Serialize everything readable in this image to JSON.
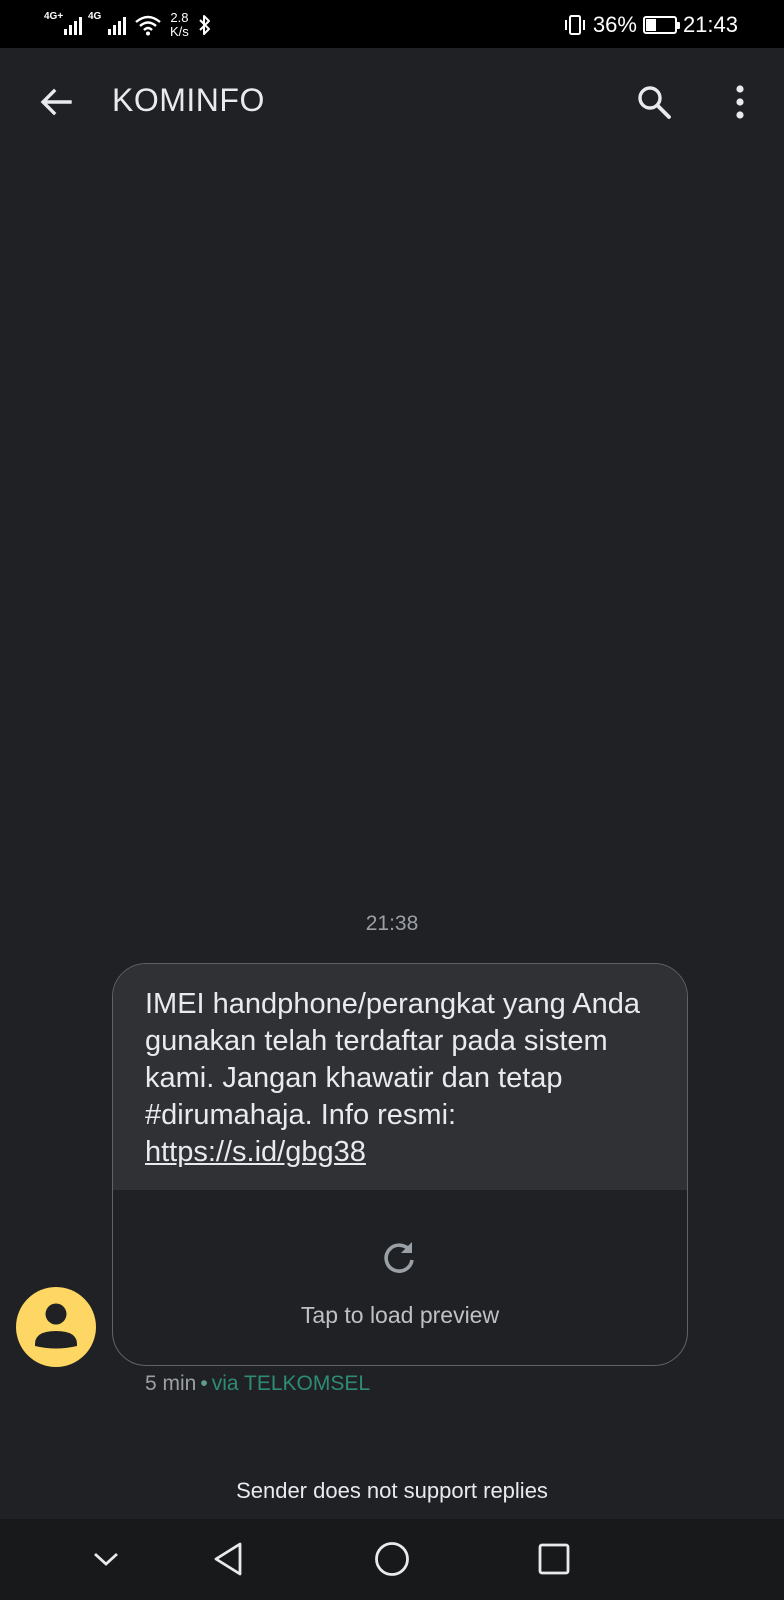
{
  "status_bar": {
    "net1": "4G+",
    "net2": "4G",
    "speed_value": "2.8",
    "speed_unit": "K/s",
    "battery_percent": "36%",
    "battery_level": 0.36,
    "clock": "21:43",
    "icons": [
      "signal-icon",
      "wifi-icon",
      "bluetooth-icon",
      "vibrate-icon",
      "battery-icon"
    ]
  },
  "app_bar": {
    "title": "KOMINFO",
    "icons": [
      "back-arrow-icon",
      "search-icon",
      "more-vert-icon"
    ]
  },
  "conversation": {
    "timestamp": "21:38",
    "message": {
      "text": "IMEI handphone/perangkat yang Anda gunakan telah terdaftar pada sistem kami. Jangan khawatir dan tetap #dirumahaja. Info resmi: ",
      "link": "https://s.id/gbg38",
      "preview_label": "Tap to load preview",
      "age": "5 min",
      "separator": "•",
      "carrier": "via TELKOMSEL"
    },
    "avatar_icon": "person-icon",
    "avatar_color": "#fdd663",
    "footer_notice": "Sender does not support replies"
  },
  "nav_bar": {
    "icons": [
      "chevron-down-icon",
      "back-triangle-icon",
      "home-circle-icon",
      "recents-square-icon"
    ]
  },
  "colors": {
    "background": "#202124",
    "bubble": "#303134",
    "carrier_accent": "#2e8b75"
  }
}
